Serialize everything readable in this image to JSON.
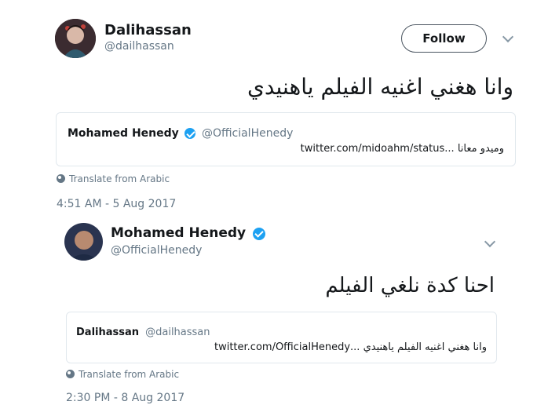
{
  "main_tweet": {
    "author_name": "Dalihassan",
    "author_handle": "@dailhassan",
    "follow_label": "Follow",
    "text": "وانا هغني اغنيه الفيلم ياهنيدي",
    "translate_label": "Translate from Arabic",
    "timestamp": "4:51 AM - 5 Aug 2017",
    "quote": {
      "author_name": "Mohamed Henedy",
      "author_handle": "@OfficialHenedy",
      "verified": true,
      "text": "وميدو معانا ...twitter.com/midoahm/status"
    }
  },
  "reply_tweet": {
    "author_name": "Mohamed Henedy",
    "author_handle": "@OfficialHenedy",
    "verified": true,
    "text": "احنا كدة نلغي الفيلم",
    "translate_label": "Translate from Arabic",
    "timestamp": "2:30 PM - 8 Aug 2017",
    "quote": {
      "author_name": "Dalihassan",
      "author_handle": "@dailhassan",
      "text": "وانا هغني اغنيه الفيلم ياهنيدي ...twitter.com/OfficialHenedy"
    }
  },
  "colors": {
    "verified_blue": "#1da1f2",
    "secondary_text": "#657786",
    "border": "#e1e8ed"
  }
}
